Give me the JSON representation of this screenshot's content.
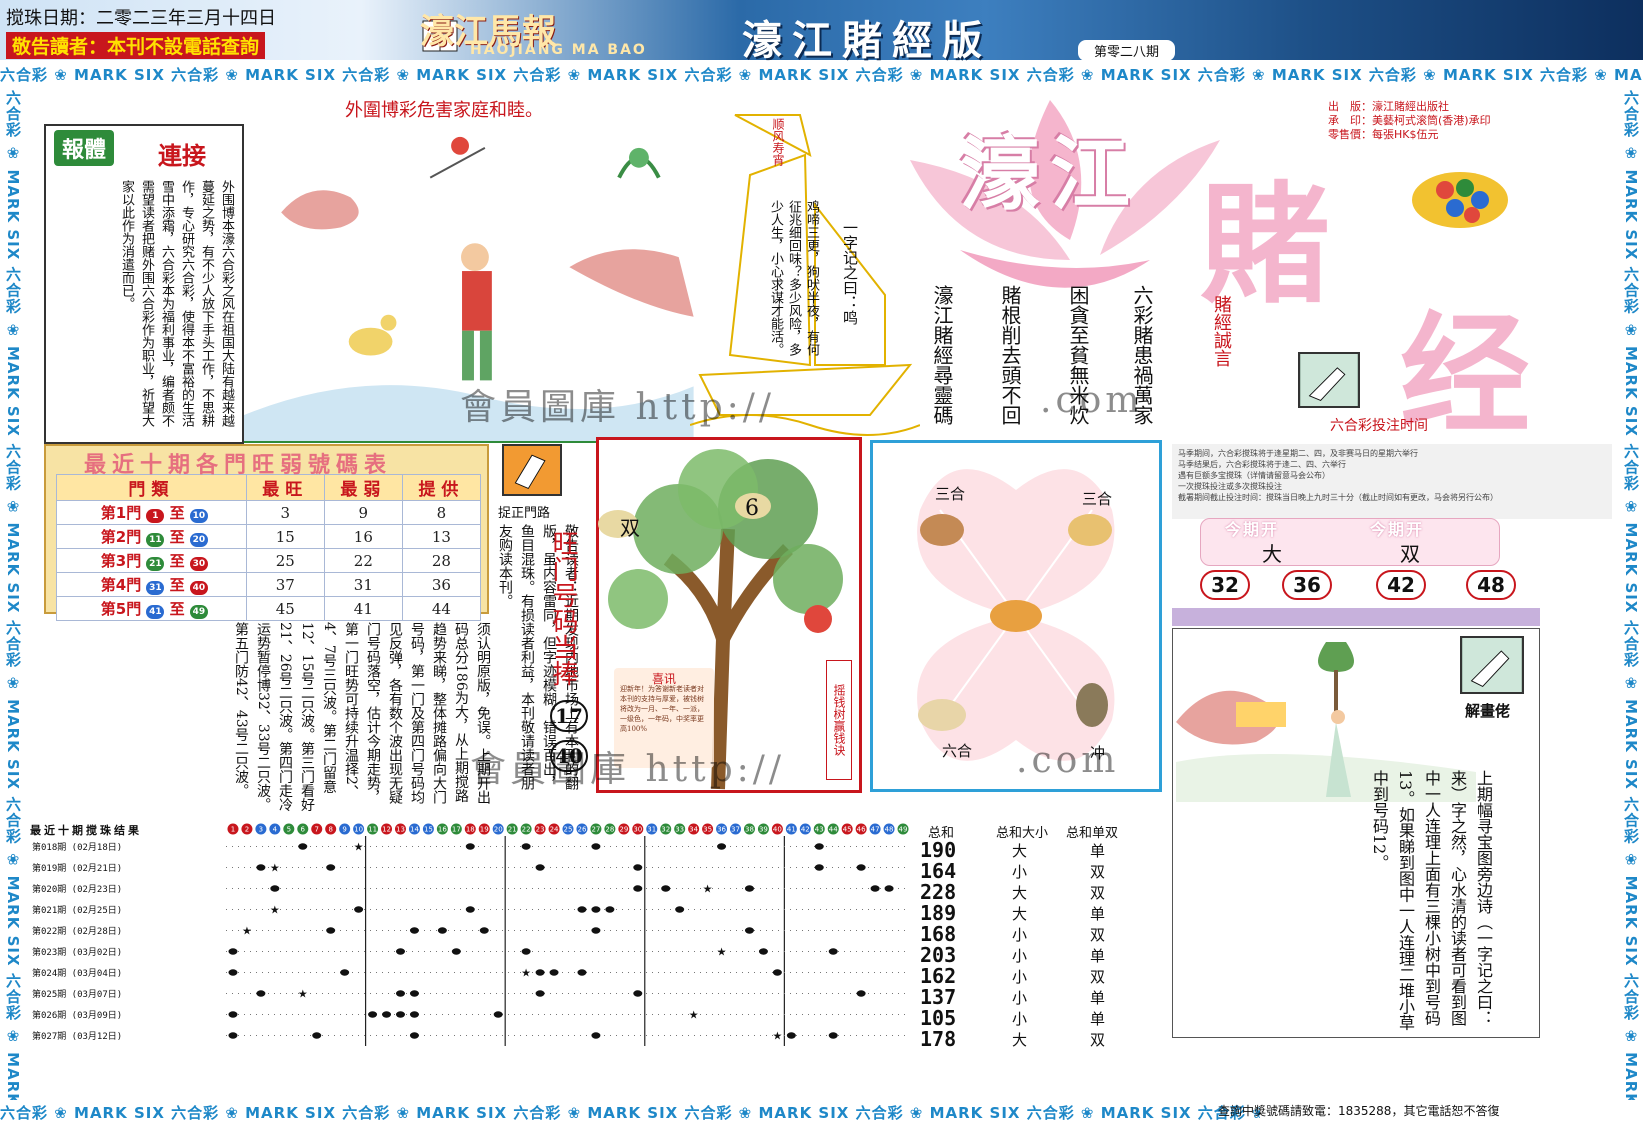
{
  "header": {
    "date": "搅珠日期：二零二三年三月十四日",
    "warning": "敬告讀者：本刊不設電話查詢",
    "paper_name": "濠江馬報",
    "paper_name_en": "HAOJIANG MA BAO",
    "edition_title": "濠江賭經版",
    "issue_no": "第零二八期"
  },
  "border_band": "六合彩 ❀ MARK SIX 六合彩 ❀ MARK SIX 六合彩 ❀ MARK SIX 六合彩 ❀ MARK SIX 六合彩 ❀ MARK SIX 六合彩 ❀ MARK SIX 六合彩 ❀ MARK SIX 六合彩 ❀ MARK SIX 六合彩 ❀ MARK SIX 六合彩 ❀ MARK SIX",
  "cartoon": {
    "title": "外圍博彩危害家庭和睦。"
  },
  "news": {
    "badge": "報體",
    "badge2": "連接",
    "text": "外围博本濠六合彩之风在祖国大陆有越来越蔓延之势，有不少人放下手头工作，不思耕作，专心研究六合彩，使得本不富裕的生活雪中添霜，六合彩本为福利事业，编者颇不需望读者把赌外围六合彩作为职业，祈望大家以此作为消遣而已。"
  },
  "sail": {
    "flag": "顺风寿宵",
    "poem": "鸡啼三更，狗吠半夜，有何征兆细回味？多少风险，多少人生，小心求谋才能活。",
    "lead": "一字记之曰：鸣"
  },
  "lotus": {
    "title_a": "濠江",
    "title_b": "賭",
    "title_c": "经",
    "columns": [
      "六彩賭患禍萬家",
      "困貪至貧無米炊",
      "賭根削去頭不回",
      "濠江賭經尋靈碼"
    ],
    "motto": "賭經誠言",
    "publisher": [
      "出　版：濠江賭經出版社",
      "承　印：美藝柯式滚筒(香港)承印",
      "零售價：每張HK$伍元"
    ]
  },
  "time_section": {
    "title": "六合彩投注时间",
    "notes": [
      "马季期间，六合彩搅珠将于逢星期二、四，及非赛马日的星期六举行",
      "马季结果后，六合彩搅珠将于逢二、四、六举行",
      "遇有巨额多宝搅珠（详情请留意马会公布）",
      "一次搅珠投注或多次搅珠投注",
      "截署期间截止投注时间：搅珠当日晚上九时三十分（截止时间如有更改，马会将另行公布）"
    ]
  },
  "result": {
    "label": "今期开",
    "size": "大",
    "parity": "双",
    "numbers": [
      "32",
      "36",
      "42",
      "48"
    ]
  },
  "rank_table": {
    "title": "最近十期各門旺弱號碼表",
    "headers": [
      "門類",
      "最旺",
      "最弱",
      "提供"
    ],
    "rows": [
      {
        "gate": "第1門",
        "from": "1",
        "to": "10",
        "hot": "3",
        "cold": "9",
        "tip": "8"
      },
      {
        "gate": "第2門",
        "from": "11",
        "to": "20",
        "hot": "15",
        "cold": "16",
        "tip": "13"
      },
      {
        "gate": "第3門",
        "from": "21",
        "to": "30",
        "hot": "25",
        "cold": "22",
        "tip": "28"
      },
      {
        "gate": "第4門",
        "from": "31",
        "to": "40",
        "hot": "37",
        "cold": "31",
        "tip": "36"
      },
      {
        "gate": "第5門",
        "from": "41",
        "to": "49",
        "hot": "45",
        "cold": "41",
        "tip": "44"
      }
    ],
    "sep": "至"
  },
  "zhui": {
    "label": "捉正門路",
    "wang_title": "旺门号码当捧",
    "num1": "17",
    "num2": "40",
    "notice": "敬告读者：近期发现内地市场上有本刊的翻版，虽内容雷同，但字迹模糊，错误百出，鱼目混珠。有损读者利益，本刊敬请读者朋友购读本刊。"
  },
  "analysis": {
    "text": "须认明原版，免误。上期开出码总分186为大，从上期搅路趋势来睇，整体摊路偏向大门号码，第一门及第四门号码均见反弹，各有数个波出现无疑门号码落空，估计今期走势，第一门旺势可持续升温择2、4、7号三只波。第二门留意12、15号二只波。第三门看好21、26号二只波。第四门走冷运势暂停博32、33号二只波。第五门防42、43号二只波。"
  },
  "tree": {
    "left_label": "双",
    "right_label": "6",
    "side": "摇钱树赢钱诀",
    "sign_title": "喜讯",
    "sign_text": "迎新年！为答谢新老读者对本刊的支持与厚爱，被钱树将改为一月、一年、一派，一级色，一年码，中奖率更高100%"
  },
  "zodiac": {
    "top_left": "三合",
    "top_right": "三合",
    "bottom_left": "六合",
    "bottom_right": "冲"
  },
  "draw_chart": {
    "title": "最近十期搅珠结果",
    "ball_numbers": [
      "1",
      "2",
      "3",
      "4",
      "5",
      "6",
      "7",
      "8",
      "9",
      "10",
      "11",
      "12",
      "13",
      "14",
      "15",
      "16",
      "17",
      "18",
      "19",
      "20",
      "21",
      "22",
      "23",
      "24",
      "25",
      "26",
      "27",
      "28",
      "29",
      "30",
      "31",
      "32",
      "33",
      "34",
      "35",
      "36",
      "37",
      "38",
      "39",
      "40",
      "41",
      "42",
      "43",
      "44",
      "45",
      "46",
      "47",
      "48",
      "49"
    ],
    "sum_header": "总和",
    "size_header": "总和大小",
    "parity_header": "总和单双",
    "rows": [
      {
        "period": "第018期",
        "date": "(02月18日)",
        "sum": "190",
        "size": "大",
        "parity": "单",
        "balls": [
          6,
          18,
          22,
          27,
          36,
          43
        ],
        "special": 10
      },
      {
        "period": "第019期",
        "date": "(02月21日)",
        "sum": "164",
        "size": "小",
        "parity": "双",
        "balls": [
          3,
          8,
          23,
          30,
          43,
          46
        ],
        "special": 4
      },
      {
        "period": "第020期",
        "date": "(02月23日)",
        "sum": "228",
        "size": "大",
        "parity": "双",
        "balls": [
          4,
          30,
          32,
          38,
          47,
          48
        ],
        "special": 35
      },
      {
        "period": "第021期",
        "date": "(02月25日)",
        "sum": "189",
        "size": "大",
        "parity": "单",
        "balls": [
          10,
          18,
          26,
          27,
          28,
          33
        ],
        "special": 4
      },
      {
        "period": "第022期",
        "date": "(02月28日)",
        "sum": "168",
        "size": "小",
        "parity": "双",
        "balls": [
          8,
          14,
          16,
          19,
          27,
          38
        ],
        "special": 2
      },
      {
        "period": "第023期",
        "date": "(03月02日)",
        "sum": "203",
        "size": "小",
        "parity": "单",
        "balls": [
          1,
          13,
          17,
          22,
          39,
          44
        ],
        "special": 36
      },
      {
        "period": "第024期",
        "date": "(03月04日)",
        "sum": "162",
        "size": "小",
        "parity": "双",
        "balls": [
          1,
          9,
          23,
          24,
          26,
          40
        ],
        "special": 22
      },
      {
        "period": "第025期",
        "date": "(03月07日)",
        "sum": "137",
        "size": "小",
        "parity": "单",
        "balls": [
          3,
          13,
          14,
          23,
          30,
          46
        ],
        "special": 6
      },
      {
        "period": "第026期",
        "date": "(03月09日)",
        "sum": "105",
        "size": "小",
        "parity": "单",
        "balls": [
          1,
          11,
          12,
          13,
          14,
          20
        ],
        "special": 34
      },
      {
        "period": "第027期",
        "date": "(03月12日)",
        "sum": "178",
        "size": "大",
        "parity": "双",
        "balls": [
          1,
          7,
          14,
          27,
          41,
          44
        ],
        "special": 40
      }
    ]
  },
  "riddle": {
    "label": "解畫佬",
    "text": "上期幅寻宝图旁边诗（一字记之曰：来）字之然，心水清的读者可看到图中一人连理上面有三棵小树中到号码13。如果睇到图中一人连理二堆小草中到号码12。"
  },
  "watermark": {
    "a": "會員圖庫 http://",
    "b": ".com",
    "c": "會員圖庫 http://",
    "d": ".com"
  },
  "contact": "查詢中獎號碼請致電：1835288，其它電話恕不答復",
  "colors": {
    "accent_red": "#c8161d",
    "accent_blue": "#1e88c8",
    "lotus_pink": "#f3a9c5",
    "table_gold": "#f7e3a4"
  }
}
